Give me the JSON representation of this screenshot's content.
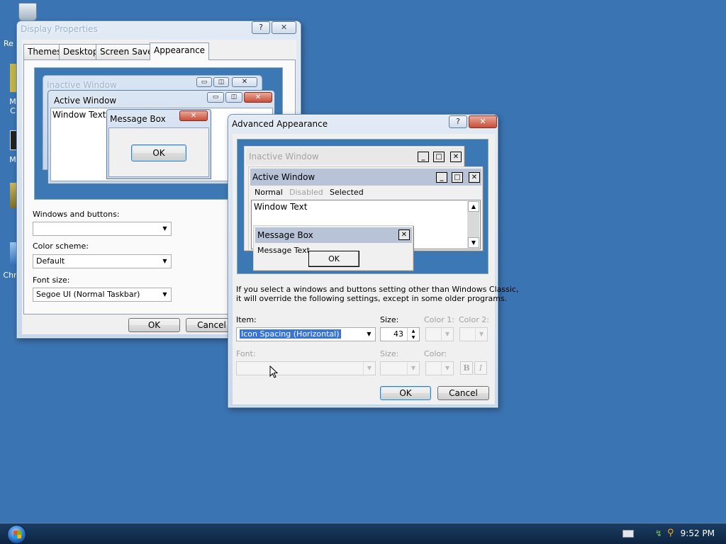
{
  "desktop": {
    "icons": [
      {
        "label": "Re"
      },
      {
        "label": "M"
      },
      {
        "label": "C"
      },
      {
        "label": "M"
      },
      {
        "label": "Chr"
      }
    ]
  },
  "display_properties": {
    "title": "Display Properties",
    "help_label": "?",
    "close_label": "✕",
    "tabs": [
      {
        "label": "Themes"
      },
      {
        "label": "Desktop"
      },
      {
        "label": "Screen Saver"
      },
      {
        "label": "Appearance"
      }
    ],
    "preview": {
      "inactive_title": "Inactive Window",
      "active_title": "Active Window",
      "window_text": "Window Text",
      "message_box_title": "Message Box",
      "ok_label": "OK"
    },
    "windows_and_buttons_label": "Windows and buttons:",
    "windows_and_buttons_value": "",
    "color_scheme_label": "Color scheme:",
    "color_scheme_value": "Default",
    "font_size_label": "Font size:",
    "font_size_value": "Segoe UI (Normal Taskbar)",
    "ok_label": "OK",
    "cancel_label": "Cancel"
  },
  "advanced_appearance": {
    "title": "Advanced Appearance",
    "help_label": "?",
    "close_label": "✕",
    "preview": {
      "inactive_title": "Inactive Window",
      "active_title": "Active Window",
      "menu_normal": "Normal",
      "menu_disabled": "Disabled",
      "menu_selected": "Selected",
      "window_text": "Window Text",
      "message_box_title": "Message Box",
      "message_text": "Message Text",
      "ok_label": "OK"
    },
    "info_text_line1": "If you select a windows and buttons setting other than Windows Classic,",
    "info_text_line2": "it will override the following settings, except in some older programs.",
    "item_label": "Item:",
    "item_value": "Icon Spacing (Horizontal)",
    "size_label": "Size:",
    "size_value": "43",
    "color1_label": "Color 1:",
    "color2_label": "Color 2:",
    "font_label": "Font:",
    "font_size_label": "Size:",
    "font_color_label": "Color:",
    "bold_label": "B",
    "italic_label": "I",
    "ok_label": "OK",
    "cancel_label": "Cancel"
  },
  "taskbar": {
    "clock": "9:52 PM"
  },
  "colors": {
    "desktop": "#3b74b2",
    "taskbar": "#0c2441",
    "classic_title_active": "#b9c3d8",
    "selection": "#3875d7"
  }
}
